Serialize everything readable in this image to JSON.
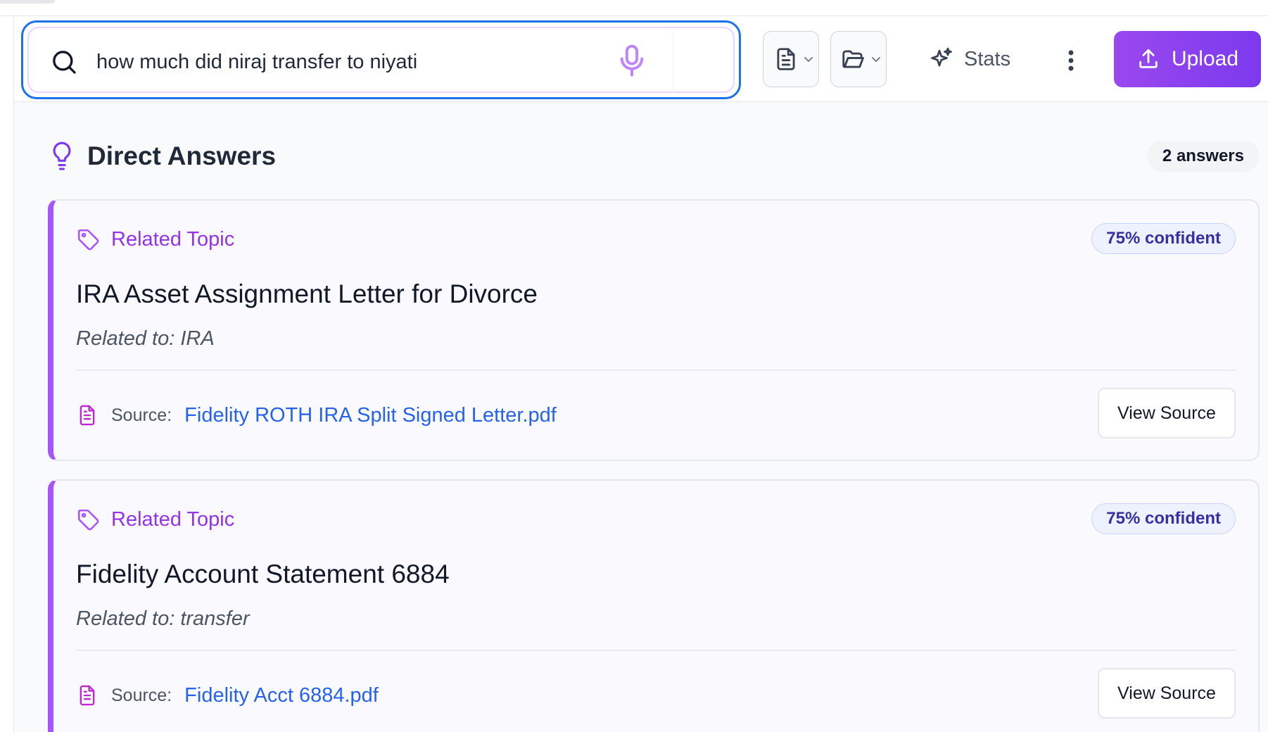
{
  "search": {
    "query": "how much did niraj transfer to niyati"
  },
  "toolbar": {
    "stats_label": "Stats",
    "upload_label": "Upload"
  },
  "section": {
    "title": "Direct Answers",
    "count_label": "2 answers"
  },
  "answers": [
    {
      "tag": "Related Topic",
      "confidence": "75% confident",
      "title": "IRA Asset Assignment Letter for Divorce",
      "related": "Related to: IRA",
      "source_label": "Source:",
      "source_file": "Fidelity ROTH IRA Split Signed Letter.pdf",
      "view_label": "View Source"
    },
    {
      "tag": "Related Topic",
      "confidence": "75% confident",
      "title": "Fidelity Account Statement 6884",
      "related": "Related to: transfer",
      "source_label": "Source:",
      "source_file": "Fidelity Acct 6884.pdf",
      "view_label": "View Source"
    }
  ],
  "colors": {
    "accent_purple": "#9333ea",
    "focus_blue": "#1a73e8",
    "link_blue": "#2563eb"
  },
  "icons": [
    "search-icon",
    "microphone-icon",
    "document-icon",
    "folder-icon",
    "chevron-down-icon",
    "sparkles-icon",
    "more-vertical-icon",
    "upload-icon",
    "lightbulb-icon",
    "tag-icon",
    "file-text-icon"
  ]
}
